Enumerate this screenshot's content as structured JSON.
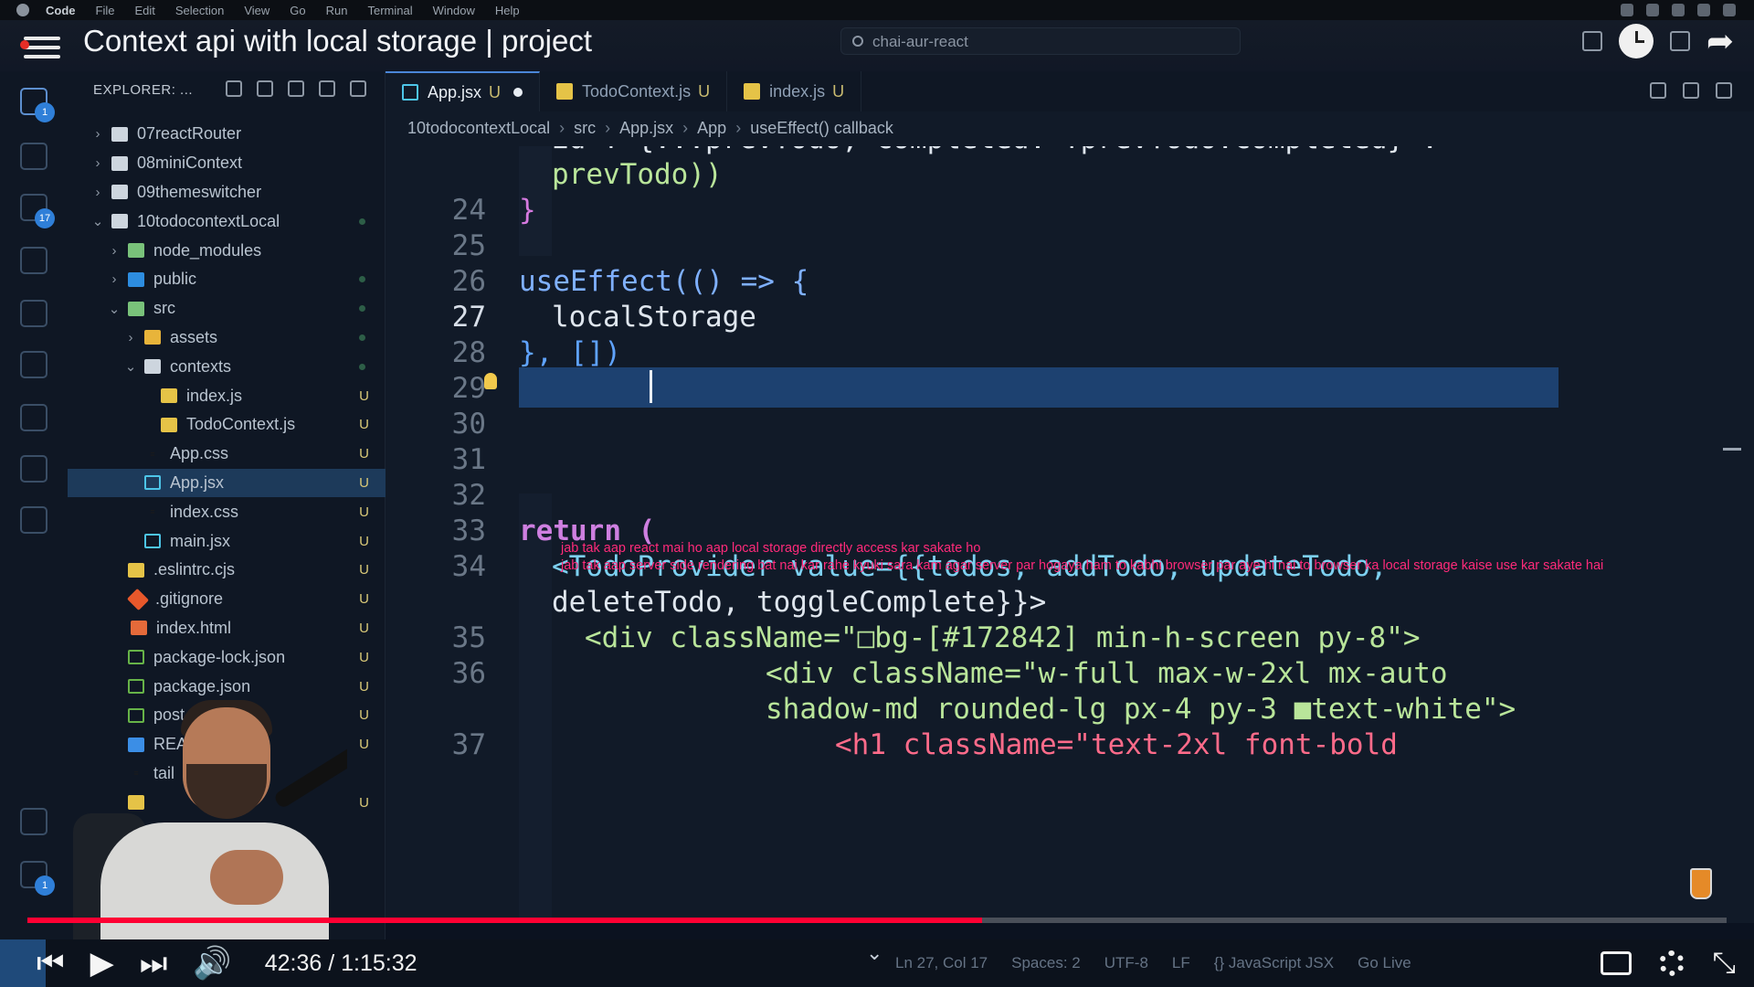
{
  "macbar": {
    "menus": [
      "Code",
      "File",
      "Edit",
      "Selection",
      "View",
      "Go",
      "Run",
      "Terminal",
      "Window",
      "Help"
    ]
  },
  "video": {
    "title": "Context api with local storage | project",
    "time": "42:36 / 1:15:32",
    "progress_fraction": 0.562
  },
  "search": {
    "text": "chai-aur-react"
  },
  "explorer": {
    "header": "EXPLORER: ...",
    "items": [
      {
        "label": "07reactRouter",
        "kind": "folder",
        "depth": 0,
        "expanded": false,
        "status": ""
      },
      {
        "label": "08miniContext",
        "kind": "folder",
        "depth": 0,
        "expanded": false,
        "status": ""
      },
      {
        "label": "09themeswitcher",
        "kind": "folder",
        "depth": 0,
        "expanded": false,
        "status": ""
      },
      {
        "label": "10todocontextLocal",
        "kind": "folder",
        "depth": 0,
        "expanded": true,
        "status": "dot"
      },
      {
        "label": "node_modules",
        "kind": "folder-green",
        "depth": 1,
        "expanded": false,
        "status": ""
      },
      {
        "label": "public",
        "kind": "folder-blue",
        "depth": 1,
        "expanded": false,
        "status": "dot"
      },
      {
        "label": "src",
        "kind": "folder-green",
        "depth": 1,
        "expanded": true,
        "status": "dot"
      },
      {
        "label": "assets",
        "kind": "folder-yellow",
        "depth": 2,
        "expanded": false,
        "status": "dot"
      },
      {
        "label": "contexts",
        "kind": "folder",
        "depth": 2,
        "expanded": true,
        "status": "dot"
      },
      {
        "label": "index.js",
        "kind": "js",
        "depth": 3,
        "status": "U"
      },
      {
        "label": "TodoContext.js",
        "kind": "js",
        "depth": 3,
        "status": "U"
      },
      {
        "label": "App.css",
        "kind": "css",
        "depth": 2,
        "status": "U"
      },
      {
        "label": "App.jsx",
        "kind": "react",
        "depth": 2,
        "status": "U",
        "selected": true
      },
      {
        "label": "index.css",
        "kind": "css",
        "depth": 2,
        "status": "U"
      },
      {
        "label": "main.jsx",
        "kind": "react",
        "depth": 2,
        "status": "U"
      },
      {
        "label": ".eslintrc.cjs",
        "kind": "js",
        "depth": 1,
        "status": "U"
      },
      {
        "label": ".gitignore",
        "kind": "git",
        "depth": 1,
        "status": "U"
      },
      {
        "label": "index.html",
        "kind": "html",
        "depth": 1,
        "status": "U"
      },
      {
        "label": "package-lock.json",
        "kind": "json",
        "depth": 1,
        "status": "U"
      },
      {
        "label": "package.json",
        "kind": "json",
        "depth": 1,
        "status": "U"
      },
      {
        "label": "post",
        "kind": "json",
        "depth": 1,
        "status": "U"
      },
      {
        "label": "REA",
        "kind": "info",
        "depth": 1,
        "status": "U"
      },
      {
        "label": "tail",
        "kind": "css",
        "depth": 1,
        "status": ""
      },
      {
        "label": "",
        "kind": "js",
        "depth": 1,
        "status": "U"
      }
    ]
  },
  "tabs": [
    {
      "label": "App.jsx",
      "mod": "U",
      "active": true,
      "dirty": true,
      "icon": "react"
    },
    {
      "label": "TodoContext.js",
      "mod": "U",
      "active": false,
      "icon": "js"
    },
    {
      "label": "index.js",
      "mod": "U",
      "active": false,
      "icon": "js"
    }
  ],
  "breadcrumbs": [
    "10todocontextLocal",
    "src",
    "App.jsx",
    "App",
    "useEffect() callback"
  ],
  "editor": {
    "line_numbers": [
      "24",
      "25",
      "26",
      "27",
      "28",
      "29",
      "30",
      "31",
      "32",
      "33",
      "34",
      "35",
      "36",
      "37"
    ],
    "current_line": "27",
    "code": {
      "wrap1": "id ? {...prevTodo, completed: !prevTodo.completed} :",
      "wrap2": "prevTodo))",
      "l24": "}",
      "l26": "useEffect(() => {",
      "l27": "localStorage",
      "l28": "}, [])",
      "l33": "return (",
      "l34a": "<TodoProvider value={{todos, addTodo, updateTodo,",
      "l34b": "deleteTodo, toggleComplete}}>",
      "l35": "<div className=\"□bg-[#172842] min-h-screen py-8\">",
      "l36a": "<div className=\"w-full max-w-2xl mx-auto",
      "l36b": "shadow-md rounded-lg px-4 py-3 ■text-white\">",
      "l37": "<h1 className=\"text-2xl font-bold"
    },
    "note": [
      "jab tak aap react mai ho aap local storage directly access kar sakate ho",
      "jab tak aap server side rendering bat nai kar rahe kyuki sara kam agar server par hogaya ham to kabhi browser par aye hi nai to browser ka local storage kaise use kar sakate hai"
    ]
  },
  "statusbar": {
    "items": [
      "Ln 27, Col 17",
      "Spaces: 2",
      "UTF-8",
      "LF",
      "{} JavaScript JSX",
      "Go Live"
    ]
  },
  "colors": {
    "accent": "#4a86d8",
    "progress": "#ff0033",
    "note": "#ff2a7a",
    "selection": "#1d4170"
  }
}
